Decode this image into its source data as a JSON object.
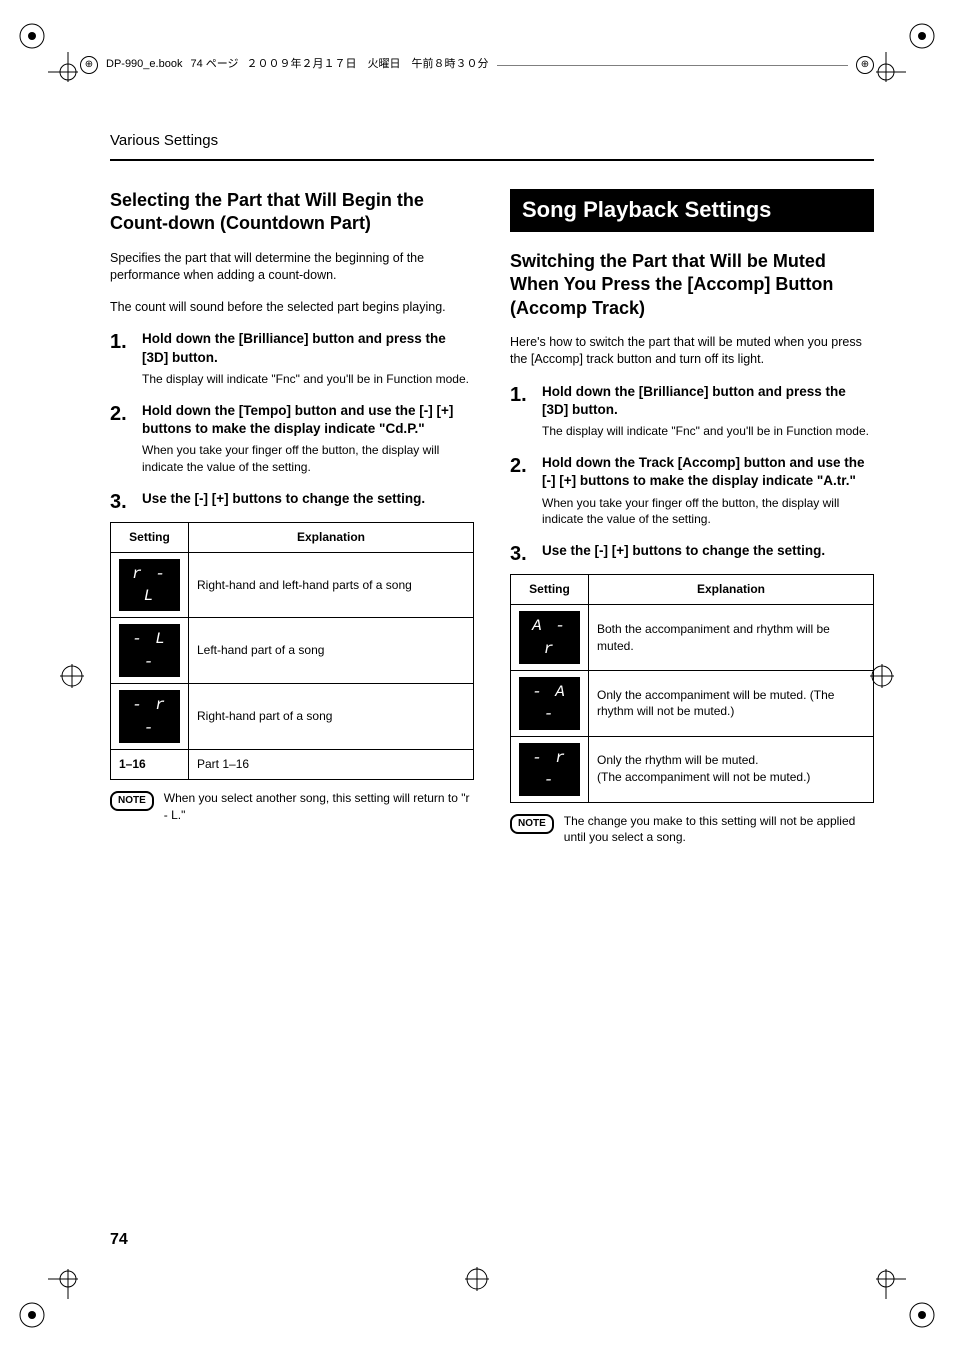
{
  "header": {
    "file": "DP-990_e.book",
    "page_label": "74 ページ",
    "date": "２００９年２月１７日　火曜日　午前８時３０分"
  },
  "running_head": "Various Settings",
  "left": {
    "title": "Selecting the Part that Will Begin the Count-down (Countdown Part)",
    "intro1": "Specifies the part that will determine the beginning of the performance when adding a count-down.",
    "intro2": "The count will sound before the selected part begins playing.",
    "steps": [
      {
        "head": "Hold down the [Brilliance] button and press the [3D] button.",
        "body": "The display will indicate \"Fnc\" and you'll be in Function mode."
      },
      {
        "head": "Hold down the [Tempo] button and use the [-] [+] buttons to make the display indicate \"Cd.P.\"",
        "body": "When you take your finger off the button, the display will indicate the value of the setting."
      },
      {
        "head": "Use the [-] [+] buttons to change the setting.",
        "body": ""
      }
    ],
    "table": {
      "cols": [
        "Setting",
        "Explanation"
      ],
      "rows": [
        {
          "disp": "r - L",
          "exp": "Right-hand and left-hand parts of a song"
        },
        {
          "disp": "- L -",
          "exp": "Left-hand part of a song"
        },
        {
          "disp": "- r -",
          "exp": "Right-hand part of a song"
        },
        {
          "disp_text": "1–16",
          "exp": "Part 1–16"
        }
      ]
    },
    "note": "When you select another song, this setting will return to \"r - L.\""
  },
  "right": {
    "banner": "Song Playback Settings",
    "title": "Switching the Part that Will be Muted When You Press the [Accomp] Button (Accomp Track)",
    "intro": "Here's how to switch the part that will be muted when you press the [Accomp] track button and turn off its light.",
    "steps": [
      {
        "head": "Hold down the [Brilliance] button and press the [3D] button.",
        "body": "The display will indicate \"Fnc\" and you'll be in Function mode."
      },
      {
        "head": "Hold down the Track [Accomp] button and use the [-] [+] buttons to make the display indicate \"A.tr.\"",
        "body": "When you take your finger off the button, the display will indicate the value of the setting."
      },
      {
        "head": "Use the [-] [+] buttons to change the setting.",
        "body": ""
      }
    ],
    "table": {
      "cols": [
        "Setting",
        "Explanation"
      ],
      "rows": [
        {
          "disp": "A - r",
          "exp": "Both the accompaniment and rhythm will be muted."
        },
        {
          "disp": "- A -",
          "exp": "Only the accompaniment will be muted. (The rhythm will not be muted.)"
        },
        {
          "disp": "- r -",
          "exp": "Only the rhythm will be muted.\n(The accompaniment will not be muted.)"
        }
      ]
    },
    "note": "The change you make to this setting will not be applied until you select a song."
  },
  "note_label": "NOTE",
  "page_number": "74"
}
